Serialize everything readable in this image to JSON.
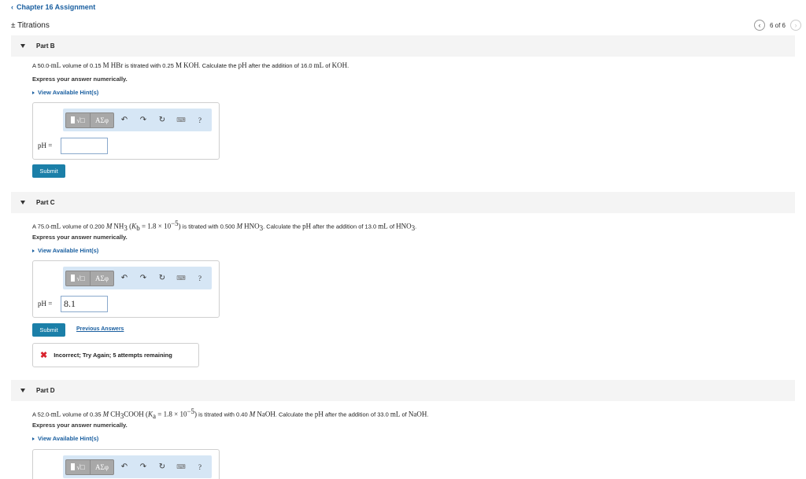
{
  "header": {
    "back_label": "Chapter 16 Assignment",
    "title": "± Titrations",
    "pager": "6 of 6"
  },
  "parts": {
    "b": {
      "label": "Part B",
      "q_pre": "A 50.0-",
      "q_unit1": "mL",
      "q_mid1": " volume of 0.15 ",
      "q_conc1": "M",
      "q_species1": "HBr",
      "q_mid2": " is titrated with 0.25 ",
      "q_conc2": "M",
      "q_species2": "KOH",
      "q_mid3": ". Calculate the ",
      "q_ph": "pH",
      "q_mid4": " after the addition of 16.0 ",
      "q_unit2": "mL",
      "q_mid5": " of ",
      "q_species3": "KOH",
      "q_end": ".",
      "instruction": "Express your answer numerically.",
      "hint": "View Available Hint(s)",
      "ph_label": "pH =",
      "answer_value": "",
      "submit": "Submit"
    },
    "c": {
      "label": "Part C",
      "q_pre": "A 75.0-",
      "q_unit1": "mL",
      "q_mid1": " volume of 0.200 ",
      "q_conc1": "M",
      "q_species1": "NH",
      "q_sub1": "3",
      "q_k_open": " (",
      "q_k": "K",
      "q_k_sub": "b",
      "q_k_eq": " = 1.8 × 10",
      "q_k_exp": "−5",
      "q_k_close": ")",
      "q_mid2": " is titrated with 0.500 ",
      "q_conc2": "M",
      "q_species2": "HNO",
      "q_sub2": "3",
      "q_mid3": ". Calculate the ",
      "q_ph": "pH",
      "q_mid4": " after the addition of 13.0 ",
      "q_unit2": "mL",
      "q_mid5": " of ",
      "q_species3": "HNO",
      "q_sub3": "3",
      "q_end": ".",
      "instruction": "Express your answer numerically.",
      "hint": "View Available Hint(s)",
      "ph_label": "pH =",
      "answer_value": "8.1",
      "submit": "Submit",
      "previous_answers": "Previous Answers",
      "feedback": "Incorrect; Try Again; 5 attempts remaining"
    },
    "d": {
      "label": "Part D",
      "q_pre": "A 52.0-",
      "q_unit1": "mL",
      "q_mid1": " volume of 0.35 ",
      "q_conc1": "M",
      "q_species1": "CH",
      "q_sub1": "3",
      "q_species1b": "COOH",
      "q_k_open": " (",
      "q_k": "K",
      "q_k_sub": "a",
      "q_k_eq": " = 1.8 × 10",
      "q_k_exp": "−5",
      "q_k_close": ")",
      "q_mid2": " is titrated with 0.40 ",
      "q_conc2": "M",
      "q_species2": "NaOH",
      "q_mid3": ". Calculate the ",
      "q_ph": "pH",
      "q_mid4": " after the addition of 33.0 ",
      "q_unit2": "mL",
      "q_mid5": " of ",
      "q_species3": "NaOH",
      "q_end": ".",
      "instruction": "Express your answer numerically.",
      "hint": "View Available Hint(s)"
    }
  },
  "toolbar": {
    "greek_label": "ΑΣφ",
    "help_label": "?",
    "icons": [
      "templates-icon",
      "greek-icon",
      "undo-icon",
      "redo-icon",
      "reset-icon",
      "keyboard-icon",
      "help-icon"
    ]
  },
  "colors": {
    "link": "#1a5fa0",
    "submit_bg": "#1b7fa8",
    "toolbar_bg": "#d6e6f5",
    "error": "#d9232e",
    "header_bg": "#f4f4f4"
  }
}
